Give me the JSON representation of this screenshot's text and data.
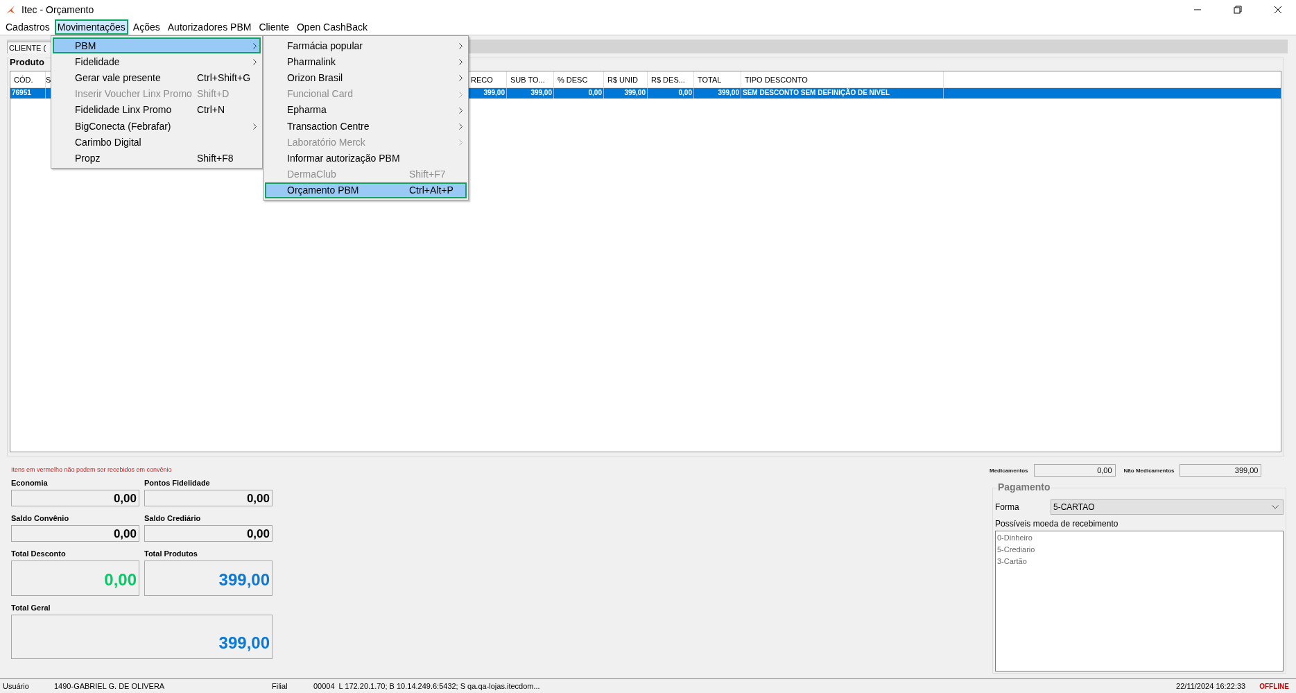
{
  "window": {
    "title": "Itec - Orçamento"
  },
  "menu_bar": [
    {
      "label": "Cadastros",
      "outlined": false
    },
    {
      "label": "Movimentações",
      "outlined": true
    },
    {
      "label": "Ações",
      "outlined": false
    },
    {
      "label": "Autorizadores PBM",
      "outlined": false
    },
    {
      "label": "Cliente",
      "outlined": false
    },
    {
      "label": "Open CashBack",
      "outlined": false
    }
  ],
  "menu": {
    "items": [
      {
        "label": "PBM",
        "submenu": true,
        "disabled": false,
        "selected": true,
        "outlined": true
      },
      {
        "label": "Fidelidade",
        "submenu": true,
        "disabled": false,
        "selected": false,
        "outlined": false
      },
      {
        "label": "Gerar vale presente",
        "shortcut": "Ctrl+Shift+G",
        "submenu": false,
        "disabled": false,
        "selected": false,
        "outlined": false
      },
      {
        "label": "Inserir Voucher Linx Promo",
        "shortcut": "Shift+D",
        "submenu": false,
        "disabled": true,
        "selected": false,
        "outlined": false
      },
      {
        "label": "Fidelidade Linx Promo",
        "shortcut": "Ctrl+N",
        "submenu": false,
        "disabled": false,
        "selected": false,
        "outlined": false
      },
      {
        "label": "BigConecta (Febrafar)",
        "submenu": true,
        "disabled": false,
        "selected": false,
        "outlined": false
      },
      {
        "label": "Carimbo Digital",
        "submenu": false,
        "disabled": false,
        "selected": false,
        "outlined": false
      },
      {
        "label": "Propz",
        "shortcut": "Shift+F8",
        "submenu": false,
        "disabled": false,
        "selected": false,
        "outlined": false
      }
    ]
  },
  "submenu": {
    "items": [
      {
        "label": "Farmácia popular",
        "submenu": true,
        "disabled": false,
        "selected": false,
        "outlined": false
      },
      {
        "label": "Pharmalink",
        "submenu": true,
        "disabled": false,
        "selected": false,
        "outlined": false
      },
      {
        "label": "Orizon Brasil",
        "submenu": true,
        "disabled": false,
        "selected": false,
        "outlined": false
      },
      {
        "label": "Funcional Card",
        "submenu": true,
        "disabled": true,
        "selected": false,
        "outlined": false
      },
      {
        "label": "Epharma",
        "submenu": true,
        "disabled": false,
        "selected": false,
        "outlined": false
      },
      {
        "label": "Transaction Centre",
        "submenu": true,
        "disabled": false,
        "selected": false,
        "outlined": false
      },
      {
        "label": "Laboratório Merck",
        "submenu": true,
        "disabled": true,
        "selected": false,
        "outlined": false
      },
      {
        "label": "Informar autorização PBM",
        "submenu": false,
        "disabled": false,
        "selected": false,
        "outlined": false
      },
      {
        "label": "DermaClub",
        "shortcut": "Shift+F7",
        "submenu": false,
        "disabled": true,
        "selected": false,
        "outlined": false
      },
      {
        "label": "Orçamento PBM",
        "shortcut": "Ctrl+Alt+P",
        "submenu": false,
        "disabled": false,
        "selected": true,
        "outlined": true
      }
    ]
  },
  "tab": {
    "label": "CLIENTE ("
  },
  "products": {
    "title": "Produto",
    "columns": [
      "CÓD.",
      "S",
      "RECO",
      "SUB TO...",
      "% DESC",
      "R$ UNID",
      "R$ DES...",
      "TOTAL",
      "TIPO DESCONTO"
    ],
    "rows": [
      {
        "selected": true,
        "cells": [
          "76951",
          null,
          "399,00",
          "399,00",
          "0,00",
          "399,00",
          "0,00",
          "399,00",
          "SEM DESCONTO SEM DEFINIÇÃO DE NIVEL"
        ]
      }
    ]
  },
  "warning": "Itens em vermelho não podem ser recebidos em convênio",
  "totals": [
    {
      "label": "Economia",
      "value": "0,00",
      "kind": "small"
    },
    {
      "label": "Pontos Fidelidade",
      "value": "0,00",
      "kind": "small"
    },
    {
      "label": "Saldo Convênio",
      "value": "0,00",
      "kind": "small"
    },
    {
      "label": "Saldo Crediário",
      "value": "0,00",
      "kind": "small"
    },
    {
      "label": "Total Desconto",
      "value": "0,00",
      "kind": "large",
      "color": "#00cc66"
    },
    {
      "label": "Total Produtos",
      "value": "399,00",
      "kind": "large",
      "color": "#0a78d4"
    },
    {
      "label": "Total Geral",
      "value": "399,00",
      "kind": "wide",
      "color": "#0a78d4"
    }
  ],
  "medicamentos": {
    "label": "Medicamentos",
    "value": "0,00"
  },
  "nao_medicamentos": {
    "label": "Não Medicamentos",
    "value": "399,00"
  },
  "payment": {
    "title": "Pagamento",
    "form_label": "Forma",
    "form_value": "5-CARTAO",
    "list_label": "Possíveis moeda de recebimento",
    "options": [
      "0-Dinheiro",
      "5-Crediario",
      "3-Cartão"
    ]
  },
  "status_bar": {
    "user_label": "Usuário",
    "user": "1490-GABRIEL G. DE OLIVERA",
    "branch_label": "Filial",
    "branch": "00004",
    "connection": "L 172.20.1.70; B 10.14.249.6:5432; S qa.qa-lojas.itecdom...",
    "datetime": "22/11/2024 16:22:33",
    "status": "OFFLINE"
  }
}
